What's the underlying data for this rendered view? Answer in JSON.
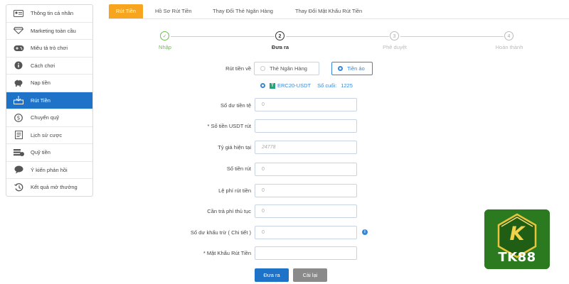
{
  "sidebar": {
    "items": [
      {
        "label": "Thông tin cá nhân",
        "icon": "user-card-icon"
      },
      {
        "label": "Marketing toàn cầu",
        "icon": "diamond-icon"
      },
      {
        "label": "Miêu tả trò chơi",
        "icon": "gamepad-icon"
      },
      {
        "label": "Cách chơi",
        "icon": "info-icon"
      },
      {
        "label": "Nạp tiền",
        "icon": "piggy-bank-icon"
      },
      {
        "label": "Rút Tiền",
        "icon": "withdraw-icon"
      },
      {
        "label": "Chuyển quỹ",
        "icon": "dollar-coin-icon"
      },
      {
        "label": "Lịch sử cược",
        "icon": "document-list-icon"
      },
      {
        "label": "Quỹ tiền",
        "icon": "money-stack-icon"
      },
      {
        "label": "Ý kiến phản hồi",
        "icon": "chat-bubble-icon"
      },
      {
        "label": "Kết quả mở thưởng",
        "icon": "history-clock-icon"
      }
    ],
    "active_index": 5
  },
  "tabs": [
    {
      "label": "Rút Tiền"
    },
    {
      "label": "Hồ Sơ Rút Tiền"
    },
    {
      "label": "Thay Đổi Thẻ Ngân Hàng"
    },
    {
      "label": "Thay Đổi Mật Khẩu Rút Tiền"
    }
  ],
  "steps": [
    {
      "number": "✓",
      "label": "Nhập",
      "state": "done"
    },
    {
      "number": "2",
      "label": "Đưa ra",
      "state": "active"
    },
    {
      "number": "3",
      "label": "Phê duyệt",
      "state": "pending"
    },
    {
      "number": "4",
      "label": "Hoàn thành",
      "state": "pending"
    }
  ],
  "withdraw_to": {
    "label": "Rút tiền về",
    "option_bank": "Thẻ Ngân Hàng",
    "option_crypto": "Tiền ảo",
    "selected": "Tiền ảo"
  },
  "network": {
    "name": "ERC20-USDT",
    "count_label": "Số cuối:",
    "count_value": "1225"
  },
  "form": {
    "current_balance": {
      "label": "Số dư tiền tệ",
      "value": "0"
    },
    "usdt_amount": {
      "label": "* Số tiền USDT rút",
      "value": ""
    },
    "exchange_rate": {
      "label": "Tỷ giá hiện tại",
      "value": "24778"
    },
    "withdraw_amount": {
      "label": "Số tiền rút",
      "value": "0"
    },
    "withdraw_fee": {
      "label": "Lệ phí rút tiền",
      "value": "0"
    },
    "fee_payable": {
      "label": "Cần trả phí thủ tục",
      "value": "0"
    },
    "deduction_balance": {
      "label": "Số dư khấu trừ ( Chi tiết )",
      "value": "0"
    },
    "withdraw_password": {
      "label": "* Mật Khẩu Rút Tiền",
      "value": ""
    }
  },
  "buttons": {
    "submit": "Đưa ra",
    "reset": "Cài lại"
  },
  "brand": {
    "logo_text": "TK88",
    "logo_letter": "K",
    "accent": "#f7a51e",
    "primary": "#1e72c8",
    "success": "#6cc04a",
    "logo_green": "#2c7a1f",
    "logo_gold": "#e8c43a"
  }
}
